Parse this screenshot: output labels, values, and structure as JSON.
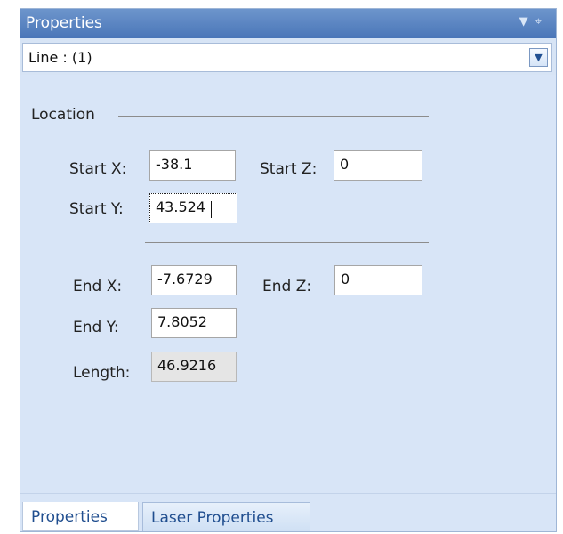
{
  "panel": {
    "title": "Properties",
    "dropdown_icon": "chevron-down-icon",
    "pin_icon": "pin-icon"
  },
  "selector": {
    "value": "Line : (1)",
    "icon": "chevron-down-icon"
  },
  "location": {
    "group_title": "Location",
    "start_x_label": "Start X:",
    "start_x_value": "-38.1",
    "start_z_label": "Start Z:",
    "start_z_value": "0",
    "start_y_label": "Start Y:",
    "start_y_value": "43.524",
    "end_x_label": "End X:",
    "end_x_value": "-7.6729",
    "end_z_label": "End Z:",
    "end_z_value": "0",
    "end_y_label": "End Y:",
    "end_y_value": "7.8052",
    "length_label": "Length:",
    "length_value": "46.9216"
  },
  "tabs": [
    {
      "label": "Properties",
      "active": true
    },
    {
      "label": "Laser Properties",
      "active": false
    }
  ]
}
